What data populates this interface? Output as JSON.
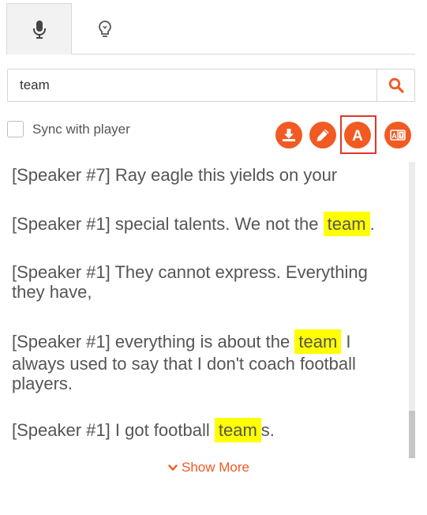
{
  "tabs": [
    {
      "icon": "microphone-icon",
      "active": true
    },
    {
      "icon": "lightbulb-icon",
      "active": false
    }
  ],
  "search": {
    "value": "team",
    "icon": "search-icon"
  },
  "sync": {
    "label": "Sync with player",
    "checked": false
  },
  "toolbar": {
    "buttons": [
      "download-icon",
      "edit-icon",
      "font-icon",
      "translate-icon"
    ],
    "highlighted": "font-icon"
  },
  "transcript": {
    "highlight_term": "team",
    "lines": [
      {
        "speaker": "[Speaker #7]",
        "text": "Ray eagle this yields on your"
      },
      {
        "speaker": "[Speaker #1]",
        "text_before": "special talents. We not the",
        "match": "team",
        "text_after": "."
      },
      {
        "speaker": "[Speaker #1]",
        "text": "They cannot express. Everything they have,"
      },
      {
        "speaker": "[Speaker #1]",
        "text_before": "everything is about the",
        "match": "team",
        "text_after": "I always used to say that I don't coach football players."
      },
      {
        "speaker": "[Speaker #1]",
        "text_before": "I got football",
        "match": "team",
        "text_after": "s."
      }
    ]
  },
  "show_more": {
    "label": "Show More"
  },
  "colors": {
    "accent": "#f15a22",
    "highlight": "#ffff00",
    "frame": "#e0362c"
  }
}
